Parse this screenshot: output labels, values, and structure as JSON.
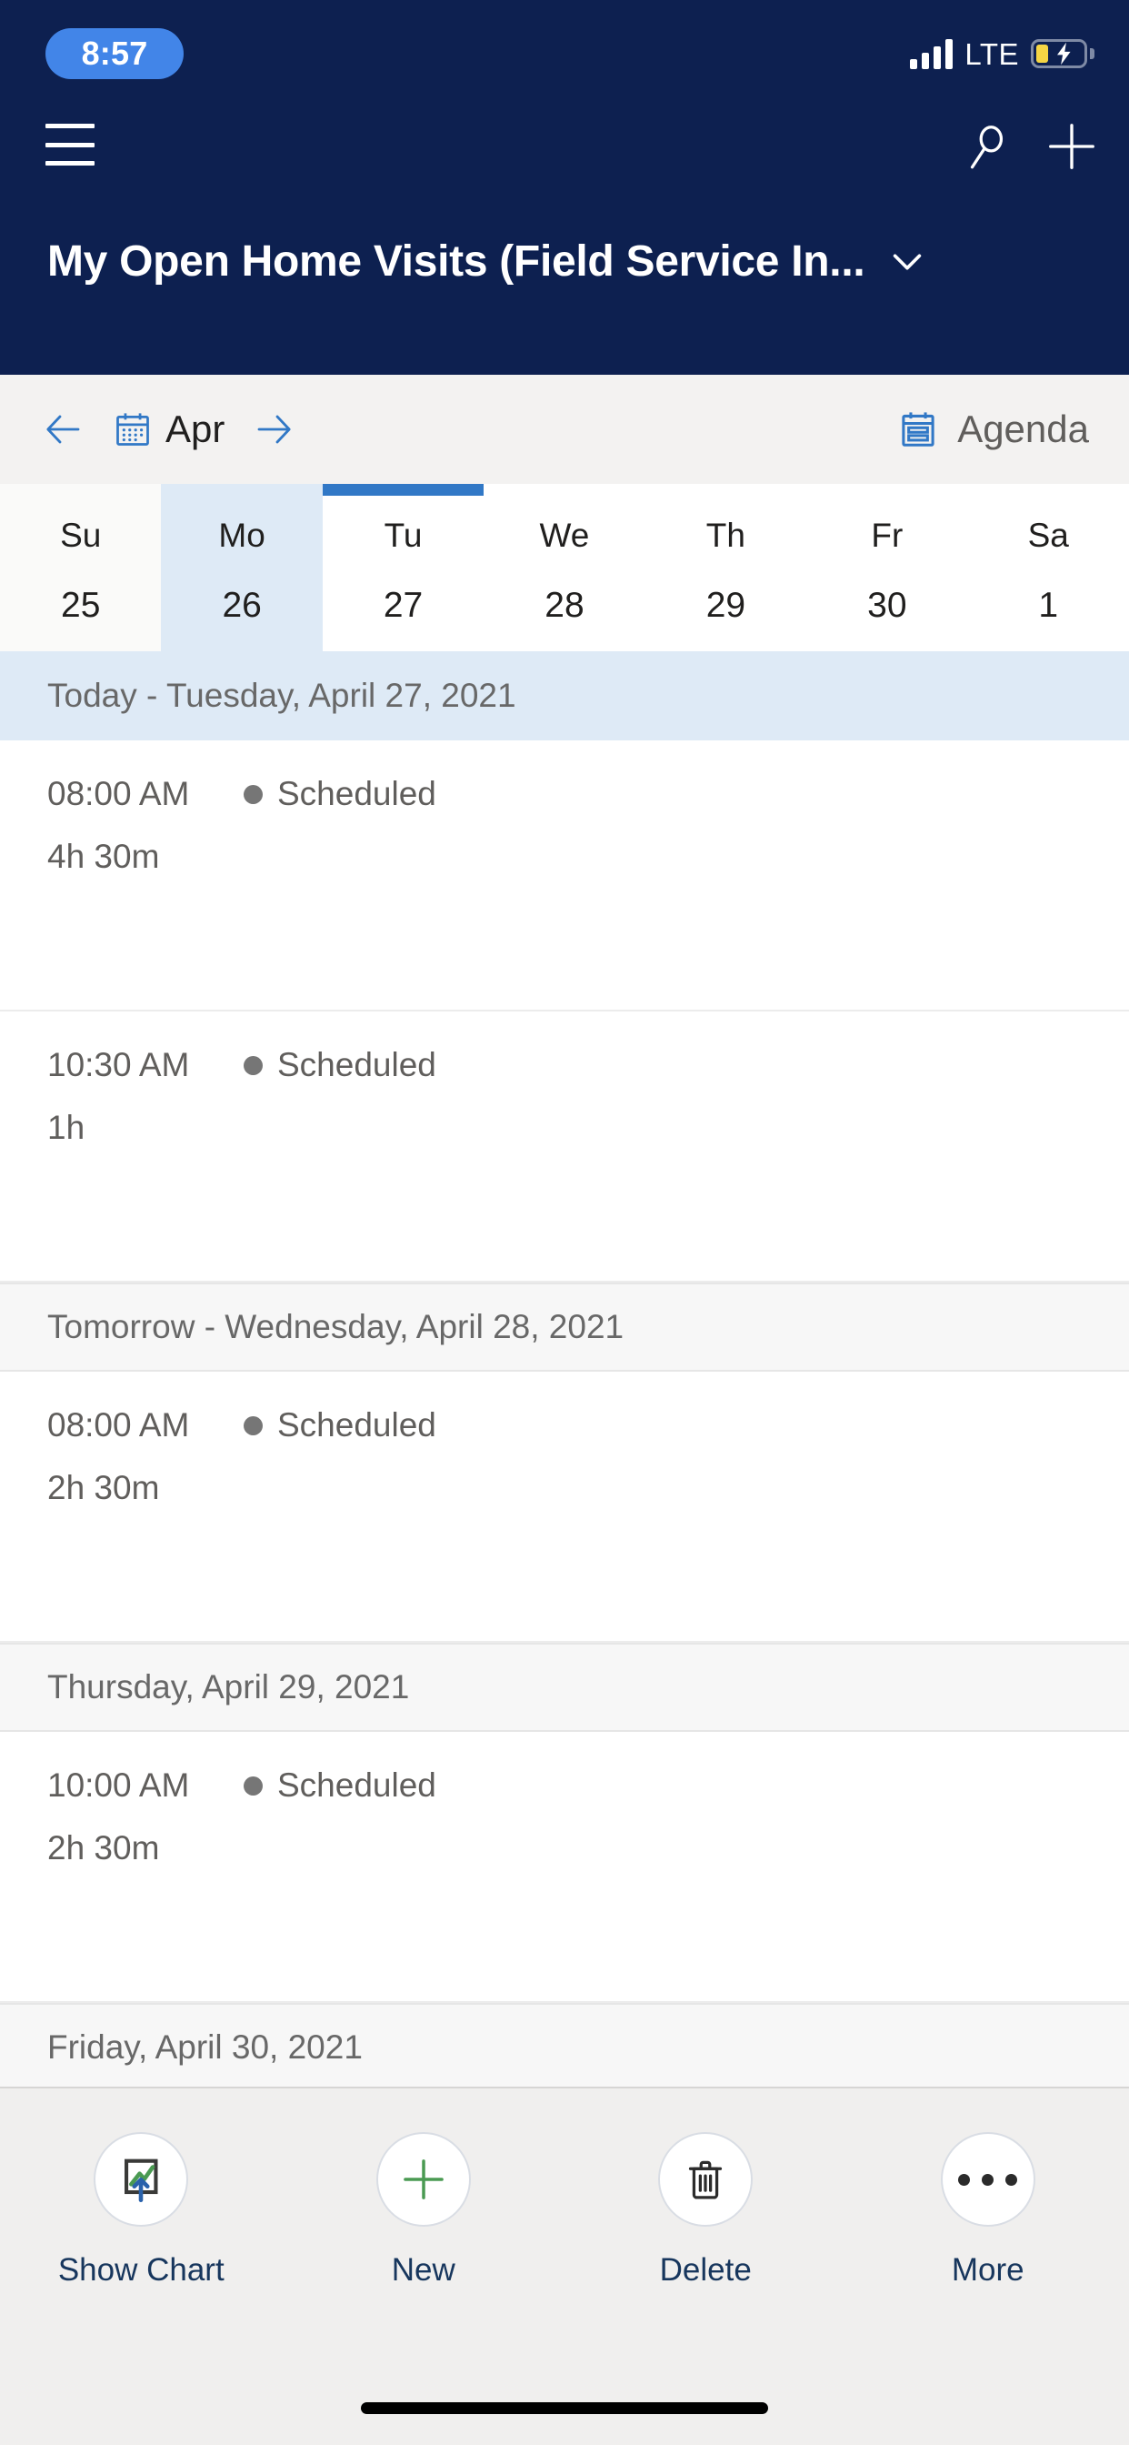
{
  "status_bar": {
    "time": "8:57",
    "network": "LTE",
    "signal_icon": "signal-bars-icon",
    "battery_icon": "battery-charging-icon"
  },
  "header": {
    "menu_icon": "hamburger-menu-icon",
    "search_icon": "search-icon",
    "add_icon": "plus-icon",
    "title": "My Open Home Visits (Field Service In...",
    "title_chevron_icon": "chevron-down-icon",
    "background_color": "#0d2050"
  },
  "calendar_bar": {
    "prev_icon": "arrow-left-icon",
    "next_icon": "arrow-right-icon",
    "calendar_icon": "calendar-icon",
    "month": "Apr",
    "agenda_icon": "agenda-calendar-icon",
    "agenda_label": "Agenda",
    "accent_color": "#3178c6"
  },
  "week_strip": {
    "selected_index": 1,
    "indicator_index": 2,
    "days": [
      {
        "dow": "Su",
        "num": "25"
      },
      {
        "dow": "Mo",
        "num": "26"
      },
      {
        "dow": "Tu",
        "num": "27"
      },
      {
        "dow": "We",
        "num": "28"
      },
      {
        "dow": "Th",
        "num": "29"
      },
      {
        "dow": "Fr",
        "num": "30"
      },
      {
        "dow": "Sa",
        "num": "1"
      }
    ]
  },
  "agenda": {
    "groups": [
      {
        "header": "Today - Tuesday, April 27, 2021",
        "is_today": true,
        "appointments": [
          {
            "time": "08:00 AM",
            "status": "Scheduled",
            "duration": "4h 30m",
            "status_color": "#767676"
          },
          {
            "time": "10:30 AM",
            "status": "Scheduled",
            "duration": "1h",
            "status_color": "#767676"
          }
        ]
      },
      {
        "header": "Tomorrow - Wednesday, April 28, 2021",
        "is_today": false,
        "appointments": [
          {
            "time": "08:00 AM",
            "status": "Scheduled",
            "duration": "2h 30m",
            "status_color": "#767676"
          }
        ]
      },
      {
        "header": "Thursday, April 29, 2021",
        "is_today": false,
        "appointments": [
          {
            "time": "10:00 AM",
            "status": "Scheduled",
            "duration": "2h 30m",
            "status_color": "#767676"
          }
        ]
      },
      {
        "header": "Friday, April 30, 2021",
        "is_today": false,
        "appointments": []
      }
    ]
  },
  "command_bar": {
    "items": [
      {
        "label": "Show Chart",
        "icon": "show-chart-icon"
      },
      {
        "label": "New",
        "icon": "plus-icon"
      },
      {
        "label": "Delete",
        "icon": "trash-icon"
      },
      {
        "label": "More",
        "icon": "ellipsis-icon"
      }
    ],
    "label_color": "#17365d"
  }
}
